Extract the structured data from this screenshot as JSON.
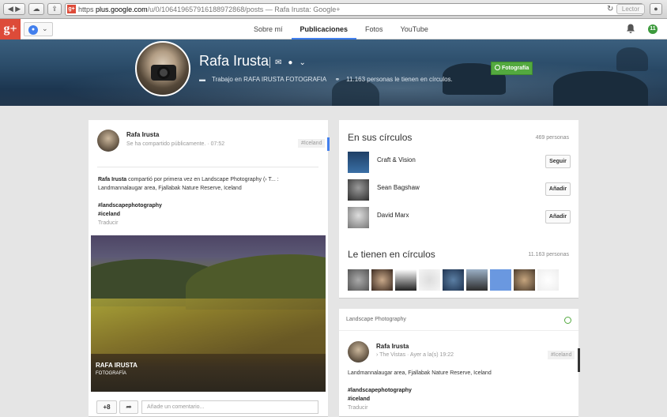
{
  "browser": {
    "https": "https",
    "domain": "plus.google.com",
    "path": "/u/0/106419657916188972868/posts",
    "title_suffix": " — Rafa Irusta: Google+",
    "reader": "Lector"
  },
  "gbar": {
    "logo": "g+",
    "tabs": [
      "Sobre mí",
      "Publicaciones",
      "Fotos",
      "YouTube"
    ],
    "active_tab": "Publicaciones",
    "notification_count": "11"
  },
  "profile": {
    "name": "Rafa Irusta",
    "work": "Trabajo en RAFA IRUSTA FOTOGRAFIA",
    "circles": "11.163 personas le tienen en círculos.",
    "badge": "Fotografía"
  },
  "post": {
    "author": "Rafa Irusta",
    "visibility": "Se ha compartido públicamente.",
    "time": "07:52",
    "tag": "#Iceland",
    "author_inline": "Rafa Irusta",
    "shared_text": "compartió por primera vez en Landscape Photography (› T... :",
    "location": "Landmannalaugar area, Fjallabak Nature Reserve, Iceland",
    "hashtag1": "#landscapephotography",
    "hashtag2": "#iceland",
    "translate": "Traducir",
    "watermark_line1": "RAFA IRUSTA",
    "watermark_line2": "FOTOGRAFÍA",
    "plus_count": "+8",
    "comment_placeholder": "Añade un comentario..."
  },
  "circles_card": {
    "title": "En sus círculos",
    "count": "469 personas",
    "people": [
      {
        "name": "Craft & Vision",
        "action": "Seguir"
      },
      {
        "name": "Sean Bagshaw",
        "action": "Añadir"
      },
      {
        "name": "David Marx",
        "action": "Añadir"
      }
    ],
    "title2": "Le tienen en círculos",
    "count2": "11.163 personas"
  },
  "community": {
    "title": "Landscape Photography",
    "author": "Rafa Irusta",
    "sub": "› The Vistas  ·  Ayer a la(s) 19:22",
    "tag": "#Iceland",
    "location": "Landmannalaugar area, Fjallabak Nature Reserve, Iceland",
    "hashtag1": "#landscapephotography",
    "hashtag2": "#iceland",
    "translate": "Traducir"
  }
}
